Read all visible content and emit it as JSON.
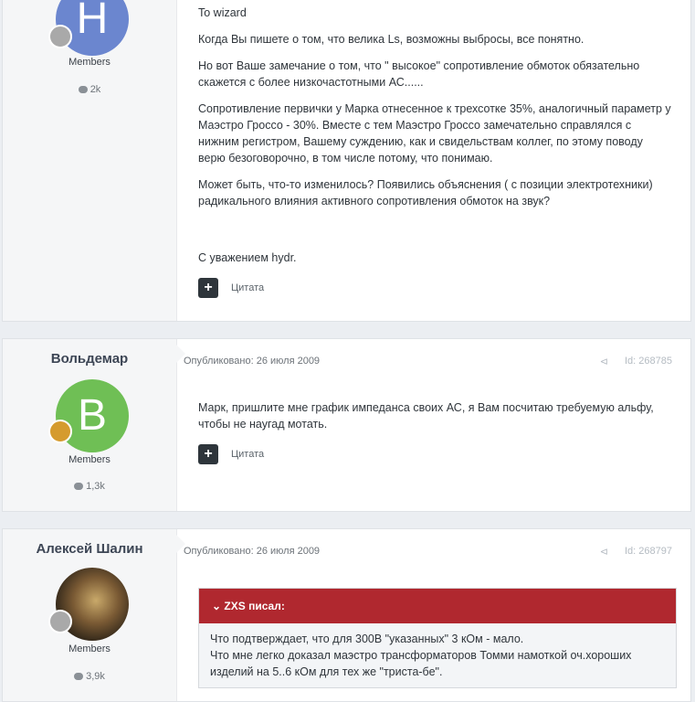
{
  "post1": {
    "avatar_letter": "H",
    "group": "Members",
    "count": "2k",
    "paragraphs": [
      "To wizard",
      "Когда Вы пишете о том, что велика Ls, возможны выбросы, все понятно.",
      "Но вот Ваше замечание о том, что \" высокое\" сопротивление обмоток обязательно скажется с более низкочастотными АС......",
      "Сопротивление первички у Марка отнесенное к трехсотке 35%, аналогичный параметр у Маэстро Гроссо - 30%. Вместе с тем Маэстро Гроссо замечательно справлялся с нижним регистром, Вашему суждению, как и свидельствам коллег, по этому поводу верю безоговорочно, в том числе потому, что понимаю.",
      "Может быть, что-то изменилось? Появились объяснения ( с позиции электротехники) радикального влияния активного сопротивления обмоток на звук?"
    ],
    "signature": "С уважением hydr.",
    "quote_label": "Цитата",
    "colors": {
      "avatar": "#6b86cf",
      "badge": "#a9a9a9"
    }
  },
  "post2": {
    "author": "Вольдемар",
    "avatar_letter": "B",
    "group": "Members",
    "count": "1,3k",
    "published": "Опубликовано: 26 июля 2009",
    "post_id": "Id: 268785",
    "text": "Марк, пришлите мне график импеданса своих АС, я Вам посчитаю требуемую альфу, чтобы не наугад мотать.",
    "quote_label": "Цитата",
    "colors": {
      "avatar": "#6fbf55",
      "badge": "#d59b2e"
    }
  },
  "post3": {
    "author": "Алексей Шалин",
    "group": "Members",
    "count": "3,9k",
    "published": "Опубликовано: 26 июля 2009",
    "post_id": "Id: 268797",
    "quote_author": "ZXS писал:",
    "quote_lines": [
      "Что подтверждает, что для 300В \"указанных\" 3 кОм - мало.",
      "Что мне легко доказал маэстро трансформаторов Томми намоткой оч.хороших изделий на 5..6 кОм для тех же \"триста-бе\"."
    ],
    "colors": {
      "quote_header": "#b0282f",
      "badge": "#a9a9a9"
    }
  }
}
